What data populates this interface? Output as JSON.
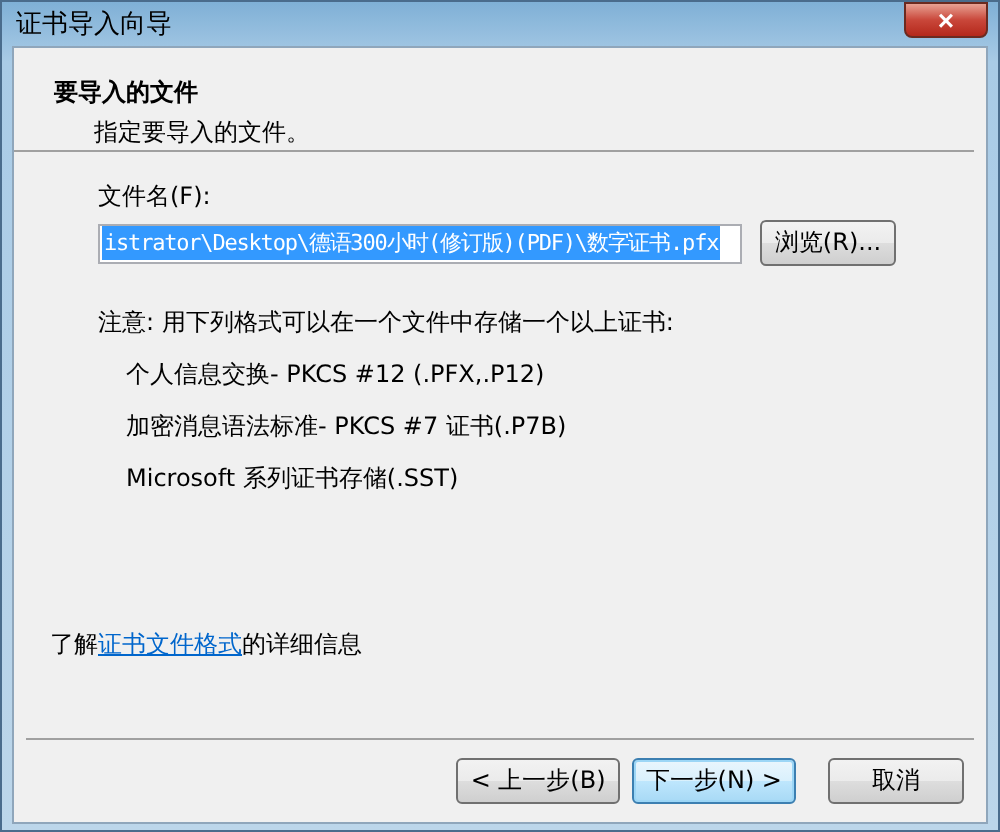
{
  "window": {
    "title": "证书导入向导",
    "close": "×"
  },
  "header": {
    "title": "要导入的文件",
    "subtitle": "指定要导入的文件。"
  },
  "file_field": {
    "label": "文件名(F):",
    "value": "istrator\\Desktop\\德语300小时(修订版)(PDF)\\数字证书.pfx",
    "selected": true
  },
  "browse_button": "浏览(R)...",
  "note": "注意: 用下列格式可以在一个文件中存储一个以上证书:",
  "formats": [
    "个人信息交换- PKCS #12 (.PFX,.P12)",
    "加密消息语法标准- PKCS #7 证书(.P7B)",
    "Microsoft 系列证书存储(.SST)"
  ],
  "info": {
    "before": "了解",
    "link": "证书文件格式",
    "after": "的详细信息"
  },
  "buttons": [
    {
      "label": "< 上一步(B)",
      "default": false
    },
    {
      "label": "下一步(N) >",
      "default": true
    },
    {
      "label": "取消",
      "default": false
    }
  ]
}
